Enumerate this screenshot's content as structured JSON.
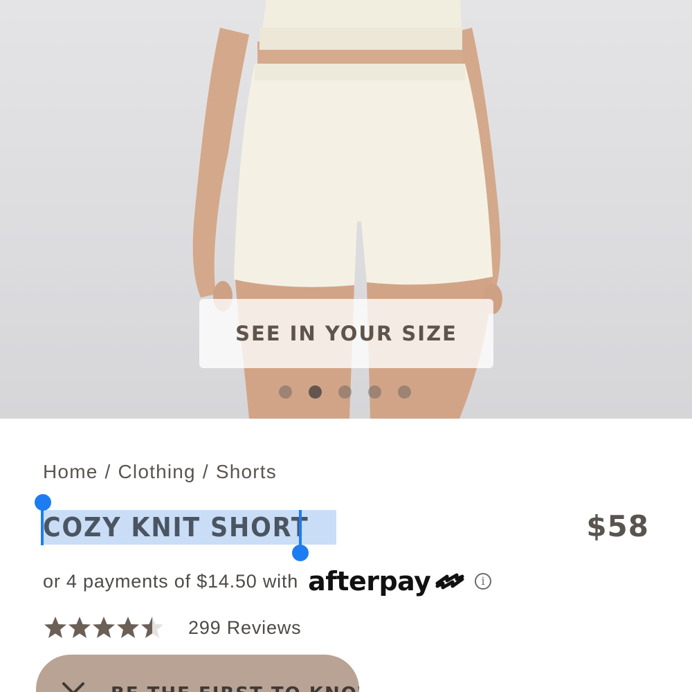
{
  "hero": {
    "size_button_label": "SEE IN YOUR SIZE",
    "carousel_count": 5,
    "carousel_active_index": 1
  },
  "breadcrumb": {
    "items": [
      "Home",
      "Clothing",
      "Shorts"
    ],
    "separator": "/"
  },
  "product": {
    "title": "COZY KNIT SHORT",
    "price": "$58"
  },
  "installments": {
    "text": "or 4 payments of $14.50 with",
    "provider": "afterpay",
    "info_icon": "info-icon"
  },
  "rating": {
    "stars": 4.5,
    "max_stars": 5,
    "reviews_label": "299 Reviews"
  },
  "notify": {
    "label": "BE THE FIRST TO KNOW",
    "icon": "close-icon"
  },
  "colors": {
    "brand_button": "#b8a394",
    "text_dark": "#5a544f",
    "star": "#6b5f56",
    "selection": "#c9ddf6",
    "selection_handle": "#1e7cf2"
  }
}
